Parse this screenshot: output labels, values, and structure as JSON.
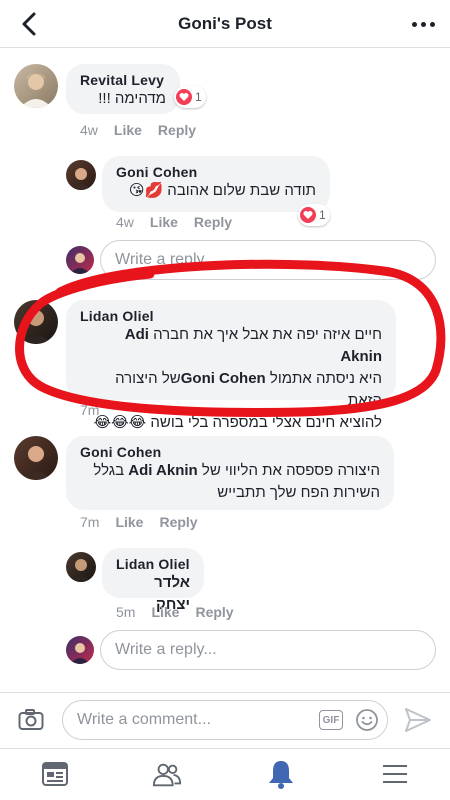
{
  "header": {
    "title": "Goni's Post"
  },
  "comments": [
    {
      "author": "Revital Levy",
      "text": "מדהימה !!!",
      "time": "4w",
      "like_label": "Like",
      "reply_label": "Reply",
      "reaction_count": "1"
    },
    {
      "author": "Goni Cohen",
      "text": "תודה שבת שלום אהובה 💋😘",
      "time": "4w",
      "like_label": "Like",
      "reply_label": "Reply",
      "reaction_count": "1"
    },
    {
      "author": "Lidan Oliel",
      "line1_mention": "Adi Aknin",
      "line1_text": "חיים איזה יפה את אבל איך את חברה",
      "line2_text1": "היא ניסתה אתמול",
      "line2_mention": "Goni Cohen",
      "line2_text2": "של היצורה הזאת",
      "line3_text": "להוציא חינם אצלי במספרה בלי בושה 😂😂😂",
      "time": "7m"
    },
    {
      "author": "Goni Cohen",
      "line1_text1": "היצורה פספסה את הליווי של",
      "line1_mention": "Adi Aknin",
      "line1_text2": "בגלל",
      "line2_text": "השירות הפח שלך תתבייש",
      "time": "7m",
      "like_label": "Like",
      "reply_label": "Reply"
    },
    {
      "author": "Lidan Oliel",
      "text": "אלדר יצחק",
      "time": "5m",
      "like_label": "Like",
      "reply_label": "Reply"
    }
  ],
  "reply_inputs": {
    "first_placeholder": "Write a reply...",
    "second_placeholder": "Write a reply..."
  },
  "composer": {
    "placeholder": "Write a comment...",
    "gif_label": "GIF"
  },
  "tabs": [
    "news-feed",
    "friends",
    "notifications",
    "menu"
  ],
  "colors": {
    "accent": "#4267b2",
    "annotation": "#e8141b",
    "heart": "#f33e58",
    "bubble": "#f2f3f5"
  }
}
